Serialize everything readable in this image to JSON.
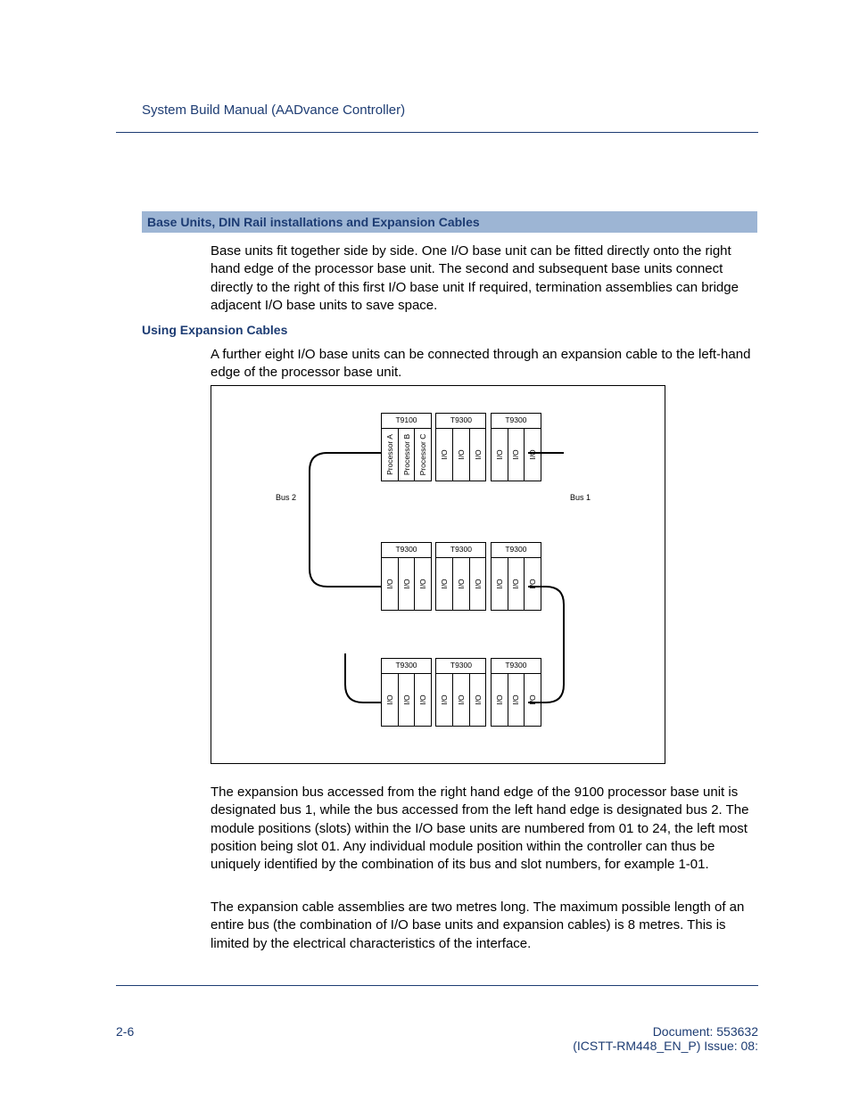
{
  "header": {
    "title": "System Build Manual  (AADvance Controller)"
  },
  "section": {
    "title": "Base Units, DIN Rail installations and Expansion Cables"
  },
  "paragraphs": {
    "p1": "Base units fit together side by side. One I/O base unit can be fitted directly onto the right hand edge of the processor base unit. The second and subsequent base units connect directly to the right of this first I/O base unit  If required, termination assemblies can bridge adjacent I/O base units to save space.",
    "sub1": "Using Expansion Cables",
    "p2": "A further eight I/O base units can be connected through an expansion cable to the left-hand edge of the processor base unit.",
    "p3": "The expansion bus accessed from the right hand edge of the 9100 processor base unit is designated bus 1, while the bus accessed from the left hand edge is designated bus 2. The module positions (slots) within the I/O base units are numbered from 01 to 24, the left most position being slot 01. Any individual module position within the controller can thus be uniquely identified by the combination of its bus and slot numbers, for example 1-01.",
    "p4": "The expansion cable assemblies are two metres long. The maximum possible length of an entire bus (the combination of I/O base units and expansion cables) is 8 metres. This is limited by the electrical characteristics of the interface."
  },
  "figure": {
    "bus1": "Bus 1",
    "bus2": "Bus 2",
    "row1": {
      "u1": {
        "title": "T9100",
        "slots": [
          "Processor A",
          "Processor B",
          "Processor C"
        ]
      },
      "u2": {
        "title": "T9300",
        "slots": [
          "I/O",
          "I/O",
          "I/O"
        ]
      },
      "u3": {
        "title": "T9300",
        "slots": [
          "I/O",
          "I/O",
          "I/O"
        ]
      }
    },
    "row2": {
      "u1": {
        "title": "T9300",
        "slots": [
          "I/O",
          "I/O",
          "I/O"
        ]
      },
      "u2": {
        "title": "T9300",
        "slots": [
          "I/O",
          "I/O",
          "I/O"
        ]
      },
      "u3": {
        "title": "T9300",
        "slots": [
          "I/O",
          "I/O",
          "I/O"
        ]
      }
    },
    "row3": {
      "u1": {
        "title": "T9300",
        "slots": [
          "I/O",
          "I/O",
          "I/O"
        ]
      },
      "u2": {
        "title": "T9300",
        "slots": [
          "I/O",
          "I/O",
          "I/O"
        ]
      },
      "u3": {
        "title": "T9300",
        "slots": [
          "I/O",
          "I/O",
          "I/O"
        ]
      }
    }
  },
  "footer": {
    "page": "2-6",
    "doc1": "Document: 553632",
    "doc2": "(ICSTT-RM448_EN_P) Issue: 08:"
  }
}
